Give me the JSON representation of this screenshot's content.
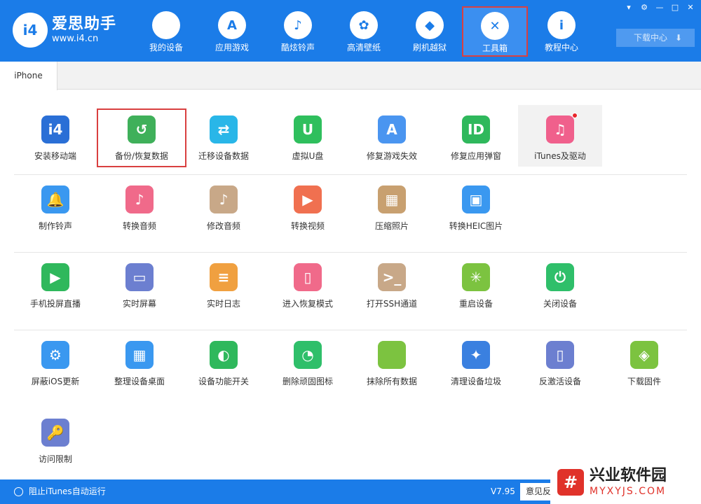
{
  "app": {
    "logo_mark": "i4",
    "logo_title": "爱思助手",
    "logo_url": "www.i4.cn"
  },
  "nav": [
    {
      "label": "我的设备",
      "glyph": ""
    },
    {
      "label": "应用游戏",
      "glyph": "A"
    },
    {
      "label": "酷炫铃声",
      "glyph": "♪"
    },
    {
      "label": "高清壁纸",
      "glyph": "✿"
    },
    {
      "label": "刷机越狱",
      "glyph": "◆"
    },
    {
      "label": "工具箱",
      "glyph": "✕"
    },
    {
      "label": "教程中心",
      "glyph": "i"
    }
  ],
  "window_controls": [
    "▾",
    "⚙",
    "—",
    "□",
    "✕"
  ],
  "download_center": {
    "label": "下载中心",
    "arrow": "⬇"
  },
  "device_tab": "iPhone",
  "tools": [
    [
      {
        "label": "安装移动端",
        "glyph": "i4",
        "color": "#2a6fd6"
      },
      {
        "label": "备份/恢复数据",
        "glyph": "↺",
        "color": "#3fb05a"
      },
      {
        "label": "迁移设备数据",
        "glyph": "⇄",
        "color": "#29b6e8"
      },
      {
        "label": "虚拟U盘",
        "glyph": "U",
        "color": "#2fbf5d"
      },
      {
        "label": "修复游戏失效",
        "glyph": "A",
        "color": "#4a95f0"
      },
      {
        "label": "修复应用弹窗",
        "glyph": "ID",
        "color": "#2fb85c"
      },
      {
        "label": "iTunes及驱动",
        "glyph": "♫",
        "color": "#f0608c"
      }
    ],
    [
      {
        "label": "制作铃声",
        "glyph": "🔔",
        "color": "#3a98f0"
      },
      {
        "label": "转换音频",
        "glyph": "♪",
        "color": "#f06a8a"
      },
      {
        "label": "修改音频",
        "glyph": "♪",
        "color": "#c8a888"
      },
      {
        "label": "转换视频",
        "glyph": "▶",
        "color": "#f07050"
      },
      {
        "label": "压缩照片",
        "glyph": "▦",
        "color": "#c8a070"
      },
      {
        "label": "转换HEIC图片",
        "glyph": "▣",
        "color": "#3a98f0"
      }
    ],
    [
      {
        "label": "手机投屏直播",
        "glyph": "▶",
        "color": "#2fb85c"
      },
      {
        "label": "实时屏幕",
        "glyph": "▭",
        "color": "#6c7fd0"
      },
      {
        "label": "实时日志",
        "glyph": "≡",
        "color": "#f0a040"
      },
      {
        "label": "进入恢复模式",
        "glyph": "▯",
        "color": "#f06a8a"
      },
      {
        "label": "打开SSH通道",
        "glyph": ">_",
        "color": "#c8a888"
      },
      {
        "label": "重启设备",
        "glyph": "✳",
        "color": "#7cc340"
      },
      {
        "label": "关闭设备",
        "glyph": "⏻",
        "color": "#2fbf6a"
      }
    ],
    [
      {
        "label": "屏蔽iOS更新",
        "glyph": "⚙",
        "color": "#3a98f0"
      },
      {
        "label": "整理设备桌面",
        "glyph": "▦",
        "color": "#3a98f0"
      },
      {
        "label": "设备功能开关",
        "glyph": "◐",
        "color": "#2fb85c"
      },
      {
        "label": "删除顽固图标",
        "glyph": "◔",
        "color": "#2fbf6a"
      },
      {
        "label": "抹除所有数据",
        "glyph": "",
        "color": "#7cc340"
      },
      {
        "label": "清理设备垃圾",
        "glyph": "✦",
        "color": "#3a80e0"
      },
      {
        "label": "反激活设备",
        "glyph": "▯",
        "color": "#6c7fd0"
      },
      {
        "label": "下载固件",
        "glyph": "◈",
        "color": "#7cc340"
      }
    ],
    [
      {
        "label": "访问限制",
        "glyph": "🔑",
        "color": "#6c7fd0"
      }
    ]
  ],
  "footer": {
    "itunes_label": "阻止iTunes自动运行",
    "version": "V7.95",
    "feedback": "意见反"
  },
  "watermark": {
    "logo": "#",
    "title": "兴业软件园",
    "url": "MYXYJS.COM"
  }
}
